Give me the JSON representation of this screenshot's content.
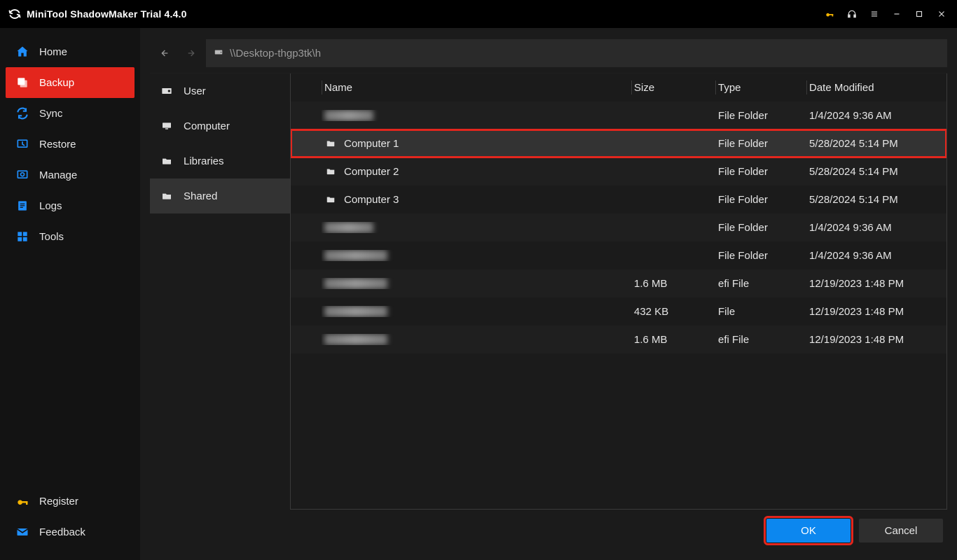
{
  "titlebar": {
    "title": "MiniTool ShadowMaker Trial 4.4.0"
  },
  "sidebar": {
    "items": [
      {
        "label": "Home"
      },
      {
        "label": "Backup"
      },
      {
        "label": "Sync"
      },
      {
        "label": "Restore"
      },
      {
        "label": "Manage"
      },
      {
        "label": "Logs"
      },
      {
        "label": "Tools"
      }
    ],
    "bottom": [
      {
        "label": "Register"
      },
      {
        "label": "Feedback"
      }
    ]
  },
  "path": {
    "value": "\\\\Desktop-thgp3tk\\h"
  },
  "folders": [
    {
      "label": "User"
    },
    {
      "label": "Computer"
    },
    {
      "label": "Libraries"
    },
    {
      "label": "Shared"
    }
  ],
  "columns": {
    "name": "Name",
    "size": "Size",
    "type": "Type",
    "date": "Date Modified"
  },
  "rows": [
    {
      "name": "",
      "blurred": true,
      "size": "",
      "type": "File Folder",
      "date": "1/4/2024 9:36 AM",
      "folder": true
    },
    {
      "name": "Computer 1",
      "size": "",
      "type": "File Folder",
      "date": "5/28/2024 5:14 PM",
      "folder": true,
      "highlight": true,
      "hover": true
    },
    {
      "name": "Computer 2",
      "size": "",
      "type": "File Folder",
      "date": "5/28/2024 5:14 PM",
      "folder": true
    },
    {
      "name": "Computer 3",
      "size": "",
      "type": "File Folder",
      "date": "5/28/2024 5:14 PM",
      "folder": true
    },
    {
      "name": "",
      "blurred": true,
      "size": "",
      "type": "File Folder",
      "date": "1/4/2024 9:36 AM",
      "folder": true
    },
    {
      "name": "",
      "blurred": true,
      "blursize": "lg",
      "size": "",
      "type": "File Folder",
      "date": "1/4/2024 9:36 AM",
      "folder": true
    },
    {
      "name": "",
      "blurred": true,
      "blursize": "lg",
      "size": "1.6 MB",
      "type": "efi File",
      "date": "12/19/2023 1:48 PM",
      "folder": false
    },
    {
      "name": "",
      "blurred": true,
      "blursize": "lg",
      "size": "432 KB",
      "type": "File",
      "date": "12/19/2023 1:48 PM",
      "folder": false
    },
    {
      "name": "",
      "blurred": true,
      "blursize": "lg",
      "size": "1.6 MB",
      "type": "efi File",
      "date": "12/19/2023 1:48 PM",
      "folder": false
    }
  ],
  "footer": {
    "ok": "OK",
    "cancel": "Cancel"
  }
}
